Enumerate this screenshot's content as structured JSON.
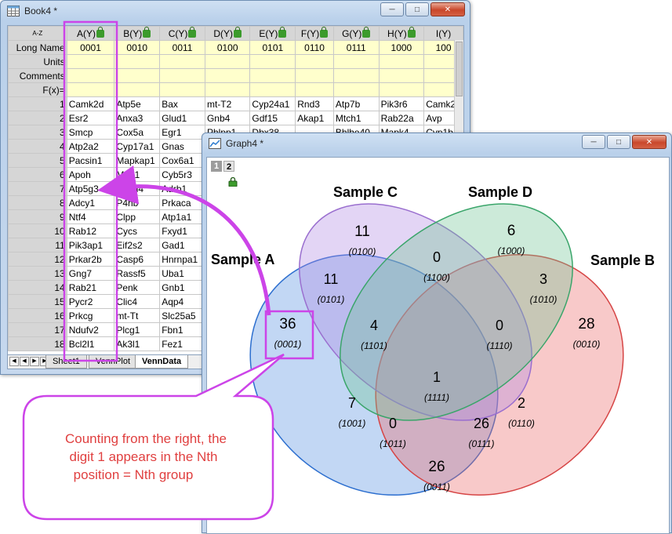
{
  "book": {
    "title": "Book4 *",
    "row_headers": [
      "Long Name",
      "Units",
      "Comments",
      "F(x)="
    ],
    "columns": [
      "A(Y)",
      "B(Y)",
      "C(Y)",
      "D(Y)",
      "E(Y)",
      "F(Y)",
      "G(Y)",
      "H(Y)",
      "I(Y)"
    ],
    "long_names": [
      "0001",
      "0010",
      "0011",
      "0100",
      "0101",
      "0110",
      "0111",
      "1000",
      "100"
    ],
    "rows": [
      {
        "n": "1",
        "cells": [
          "Camk2d",
          "Atp5e",
          "Bax",
          "mt-T2",
          "Cyp24a1",
          "Rnd3",
          "Atp7b",
          "Pik3r6",
          "Camk2"
        ]
      },
      {
        "n": "2",
        "cells": [
          "Esr2",
          "Anxa3",
          "Glud1",
          "Gnb4",
          "Gdf15",
          "Akap1",
          "Mtch1",
          "Rab22a",
          "Avp"
        ]
      },
      {
        "n": "3",
        "cells": [
          "Smcp",
          "Cox5a",
          "Egr1",
          "Phlpp1",
          "Dbx38",
          "",
          "Bhlhe40",
          "Mapk4",
          "Cyp1b"
        ]
      },
      {
        "n": "4",
        "cells": [
          "Atp2a2",
          "Cyp17a1",
          "Gnas",
          "",
          "",
          "",
          "",
          "",
          ""
        ]
      },
      {
        "n": "5",
        "cells": [
          "Pacsin1",
          "Mapkap1",
          "Cox6a1",
          "",
          "",
          "",
          "",
          "",
          ""
        ]
      },
      {
        "n": "6",
        "cells": [
          "Apoh",
          "Mrpl1",
          "Cyb5r3",
          "",
          "",
          "",
          "",
          "",
          ""
        ]
      },
      {
        "n": "7",
        "cells": [
          "Atp5g3",
          "Stmn4",
          "Adrb1",
          "",
          "",
          "",
          "",
          "",
          ""
        ]
      },
      {
        "n": "8",
        "cells": [
          "Adcy1",
          "P4hb",
          "Prkaca",
          "",
          "",
          "",
          "",
          "",
          ""
        ]
      },
      {
        "n": "9",
        "cells": [
          "Ntf4",
          "Clpp",
          "Atp1a1",
          "",
          "",
          "",
          "",
          "",
          ""
        ]
      },
      {
        "n": "10",
        "cells": [
          "Rab12",
          "Cycs",
          "Fxyd1",
          "",
          "",
          "",
          "",
          "",
          ""
        ]
      },
      {
        "n": "11",
        "cells": [
          "Pik3ap1",
          "Eif2s2",
          "Gad1",
          "",
          "",
          "",
          "",
          "",
          ""
        ]
      },
      {
        "n": "12",
        "cells": [
          "Prkar2b",
          "Casp6",
          "Hnrnpa1",
          "",
          "",
          "",
          "",
          "",
          ""
        ]
      },
      {
        "n": "13",
        "cells": [
          "Gng7",
          "Rassf5",
          "Uba1",
          "",
          "",
          "",
          "",
          "",
          ""
        ]
      },
      {
        "n": "14",
        "cells": [
          "Rab21",
          "Penk",
          "Gnb1",
          "",
          "",
          "",
          "",
          "",
          ""
        ]
      },
      {
        "n": "15",
        "cells": [
          "Pycr2",
          "Clic4",
          "Aqp4",
          "",
          "",
          "",
          "",
          "",
          ""
        ]
      },
      {
        "n": "16",
        "cells": [
          "Prkcg",
          "mt-Tt",
          "Slc25a5",
          "",
          "",
          "",
          "",
          "",
          ""
        ]
      },
      {
        "n": "17",
        "cells": [
          "Ndufv2",
          "Plcg1",
          "Fbn1",
          "",
          "",
          "",
          "",
          "",
          ""
        ]
      },
      {
        "n": "18",
        "cells": [
          "Bcl2l1",
          "Ak3l1",
          "Fez1",
          "",
          "",
          "",
          "",
          "",
          ""
        ]
      }
    ],
    "tabs": [
      "Sheet1",
      "VennPlot",
      "VennData"
    ],
    "active_tab": "VennData"
  },
  "graph": {
    "title": "Graph4 *",
    "layers": [
      "1",
      "2"
    ],
    "sets": {
      "a": "Sample A",
      "b": "Sample B",
      "c": "Sample C",
      "d": "Sample D"
    },
    "regions": [
      {
        "id": "a",
        "count": "36",
        "code": "(0001)"
      },
      {
        "id": "b",
        "count": "28",
        "code": "(0010)"
      },
      {
        "id": "c",
        "count": "11",
        "code": "(0100)"
      },
      {
        "id": "d",
        "count": "6",
        "code": "(1000)"
      },
      {
        "id": "ca",
        "count": "11",
        "code": "(0101)"
      },
      {
        "id": "cd",
        "count": "0",
        "code": "(1100)"
      },
      {
        "id": "db",
        "count": "3",
        "code": "(1010)"
      },
      {
        "id": "acd",
        "count": "4",
        "code": "(1101)"
      },
      {
        "id": "bcd",
        "count": "0",
        "code": "(1110)"
      },
      {
        "id": "abcd",
        "count": "1",
        "code": "(1111)"
      },
      {
        "id": "ad",
        "count": "7",
        "code": "(1001)"
      },
      {
        "id": "bc",
        "count": "2",
        "code": "(0110)"
      },
      {
        "id": "abd",
        "count": "0",
        "code": "(1011)"
      },
      {
        "id": "abc",
        "count": "26",
        "code": "(0111)"
      },
      {
        "id": "ab",
        "count": "26",
        "code": "(0011)"
      }
    ]
  },
  "callout": {
    "text_lines": [
      "Counting from the right, the",
      "digit 1 appears in the Nth",
      "position = Nth group"
    ]
  },
  "colors": {
    "highlight": "#cc44e8",
    "sample_a": "#2d6fcf",
    "sample_b": "#d64545",
    "sample_c": "#9a6fcf",
    "sample_d": "#3aa56a",
    "callout_text": "#e04040"
  }
}
